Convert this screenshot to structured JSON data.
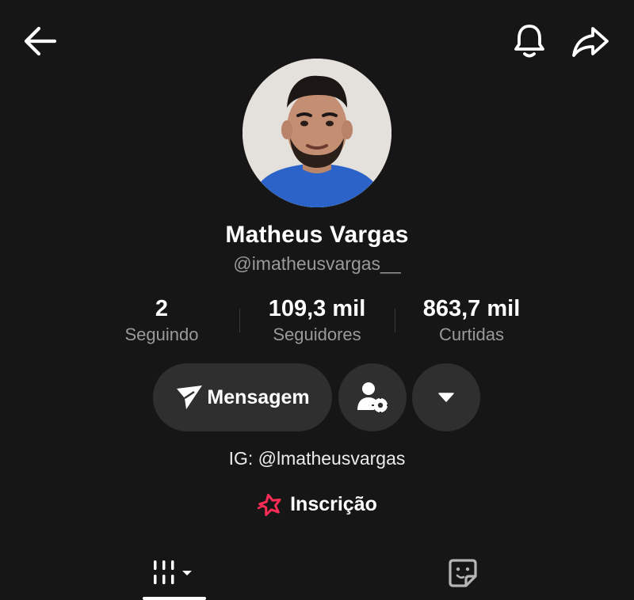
{
  "header": {
    "back_icon": "arrow-left-icon",
    "bell_icon": "bell-icon",
    "share_icon": "share-arrow-icon"
  },
  "profile": {
    "name": "Matheus Vargas",
    "handle": "@imatheusvargas__",
    "bio": "IG: @lmatheusvargas"
  },
  "stats": [
    {
      "value": "2",
      "label": "Seguindo"
    },
    {
      "value": "109,3 mil",
      "label": "Seguidores"
    },
    {
      "value": "863,7 mil",
      "label": "Curtidas"
    }
  ],
  "actions": {
    "message_label": "Mensagem",
    "message_icon": "send-plane-icon",
    "user_settings_icon": "user-gear-icon",
    "dropdown_icon": "caret-down-icon"
  },
  "subscription": {
    "label": "Inscrição",
    "icon": "subscription-star-icon",
    "icon_color": "#fe2c55"
  },
  "tabs": [
    {
      "name": "videos",
      "icon": "grid-bars-icon",
      "active": true
    },
    {
      "name": "saved",
      "icon": "sticker-icon",
      "active": false
    }
  ],
  "colors": {
    "background": "#161616",
    "button": "#2f2f2f",
    "secondary_text": "#9a9a9a",
    "accent": "#fe2c55"
  }
}
